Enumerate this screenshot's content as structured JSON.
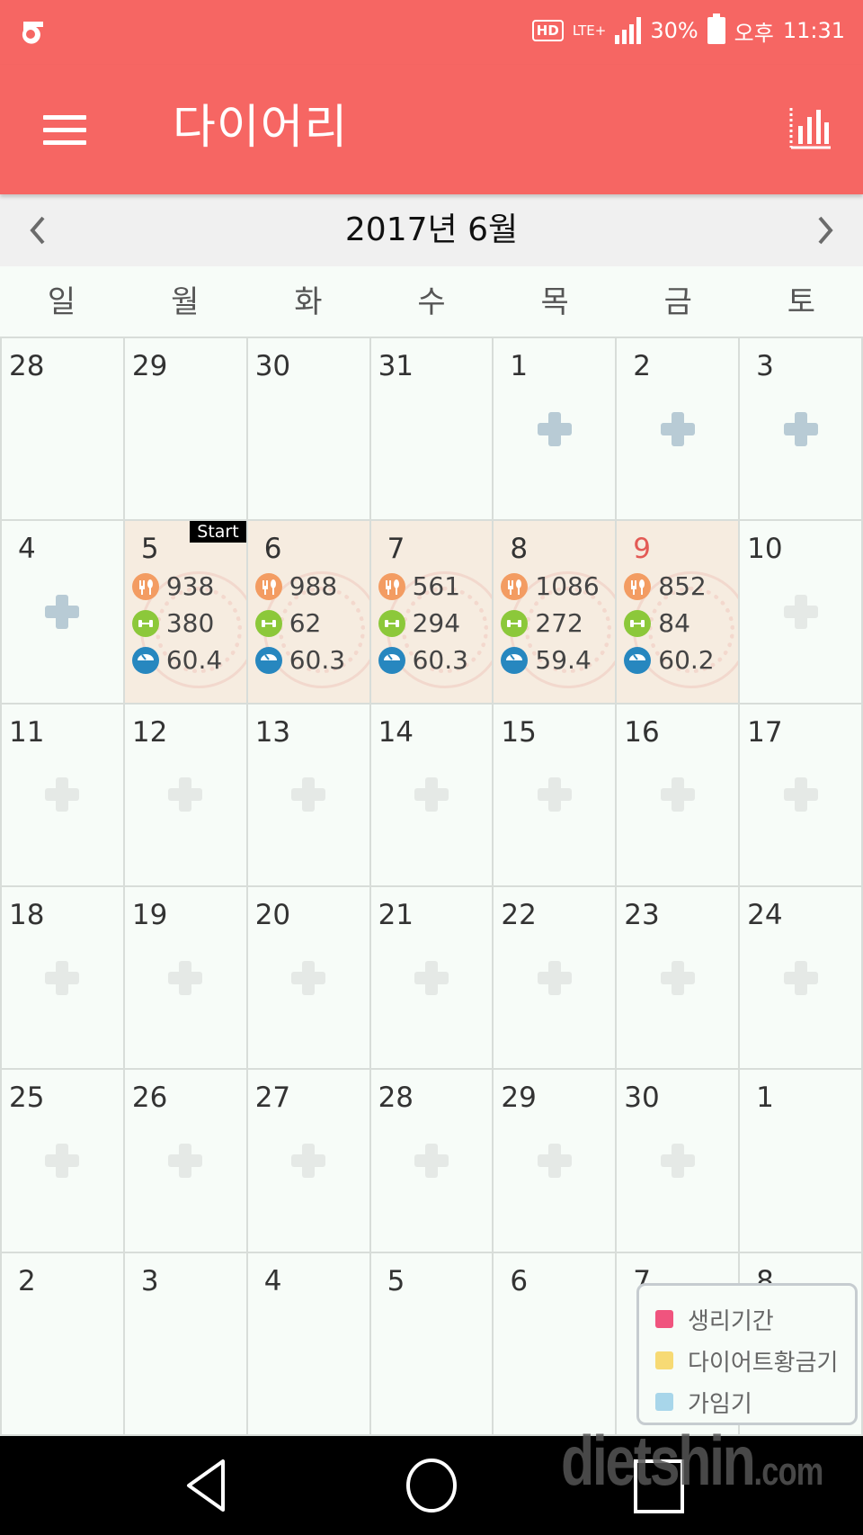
{
  "status_bar": {
    "carrier_icon": "olleh-logo-icon",
    "hd_label": "HD",
    "network_label": "LTE+",
    "signal_icon": "signal-bars-icon",
    "battery_percent": "30%",
    "battery_icon": "battery-charging-icon",
    "ampm": "오후",
    "time": "11:31"
  },
  "app_bar": {
    "menu_icon": "hamburger-menu-icon",
    "title": "다이어리",
    "stats_icon": "bar-chart-icon"
  },
  "month_nav": {
    "prev_icon": "chevron-left-icon",
    "label": "2017년 6월",
    "next_icon": "chevron-right-icon"
  },
  "weekdays": [
    "일",
    "월",
    "화",
    "수",
    "목",
    "금",
    "토"
  ],
  "weeks": [
    [
      {
        "day": "28",
        "add": "none"
      },
      {
        "day": "29",
        "add": "none"
      },
      {
        "day": "30",
        "add": "none"
      },
      {
        "day": "31",
        "add": "none"
      },
      {
        "day": "1",
        "add": "active"
      },
      {
        "day": "2",
        "add": "active"
      },
      {
        "day": "3",
        "add": "active"
      }
    ],
    [
      {
        "day": "4",
        "add": "active"
      },
      {
        "day": "5",
        "badge": "Start",
        "food": "938",
        "exercise": "380",
        "weight": "60.4"
      },
      {
        "day": "6",
        "food": "988",
        "exercise": "62",
        "weight": "60.3"
      },
      {
        "day": "7",
        "food": "561",
        "exercise": "294",
        "weight": "60.3"
      },
      {
        "day": "8",
        "food": "1086",
        "exercise": "272",
        "weight": "59.4"
      },
      {
        "day": "9",
        "today": true,
        "food": "852",
        "exercise": "84",
        "weight": "60.2"
      },
      {
        "day": "10",
        "add": "faded"
      }
    ],
    [
      {
        "day": "11",
        "add": "faded"
      },
      {
        "day": "12",
        "add": "faded"
      },
      {
        "day": "13",
        "add": "faded"
      },
      {
        "day": "14",
        "add": "faded"
      },
      {
        "day": "15",
        "add": "faded"
      },
      {
        "day": "16",
        "add": "faded"
      },
      {
        "day": "17",
        "add": "faded"
      }
    ],
    [
      {
        "day": "18",
        "add": "faded"
      },
      {
        "day": "19",
        "add": "faded"
      },
      {
        "day": "20",
        "add": "faded"
      },
      {
        "day": "21",
        "add": "faded"
      },
      {
        "day": "22",
        "add": "faded"
      },
      {
        "day": "23",
        "add": "faded"
      },
      {
        "day": "24",
        "add": "faded"
      }
    ],
    [
      {
        "day": "25",
        "add": "faded"
      },
      {
        "day": "26",
        "add": "faded"
      },
      {
        "day": "27",
        "add": "faded"
      },
      {
        "day": "28",
        "add": "faded"
      },
      {
        "day": "29",
        "add": "faded"
      },
      {
        "day": "30",
        "add": "faded"
      },
      {
        "day": "1",
        "add": "none"
      }
    ],
    [
      {
        "day": "2",
        "add": "none"
      },
      {
        "day": "3",
        "add": "none"
      },
      {
        "day": "4",
        "add": "none"
      },
      {
        "day": "5",
        "add": "none"
      },
      {
        "day": "6",
        "add": "none"
      },
      {
        "day": "7",
        "add": "none"
      },
      {
        "day": "8",
        "add": "none"
      }
    ]
  ],
  "legend": [
    {
      "label": "생리기간",
      "color": "#f0547e"
    },
    {
      "label": "다이어트황금기",
      "color": "#f7da74"
    },
    {
      "label": "가임기",
      "color": "#a8d6ea"
    }
  ],
  "nav_bar": {
    "back_icon": "back-triangle-icon",
    "home_icon": "home-circle-icon",
    "recent_icon": "recent-apps-square-icon"
  },
  "watermark": {
    "main": "dietshin",
    "suffix": ".com"
  },
  "colors": {
    "brand": "#f66663",
    "today": "#e35a55",
    "food": "#f39c62",
    "exercise": "#8cc83a",
    "weight": "#2787bf",
    "logged_bg": "#f6ece0"
  }
}
